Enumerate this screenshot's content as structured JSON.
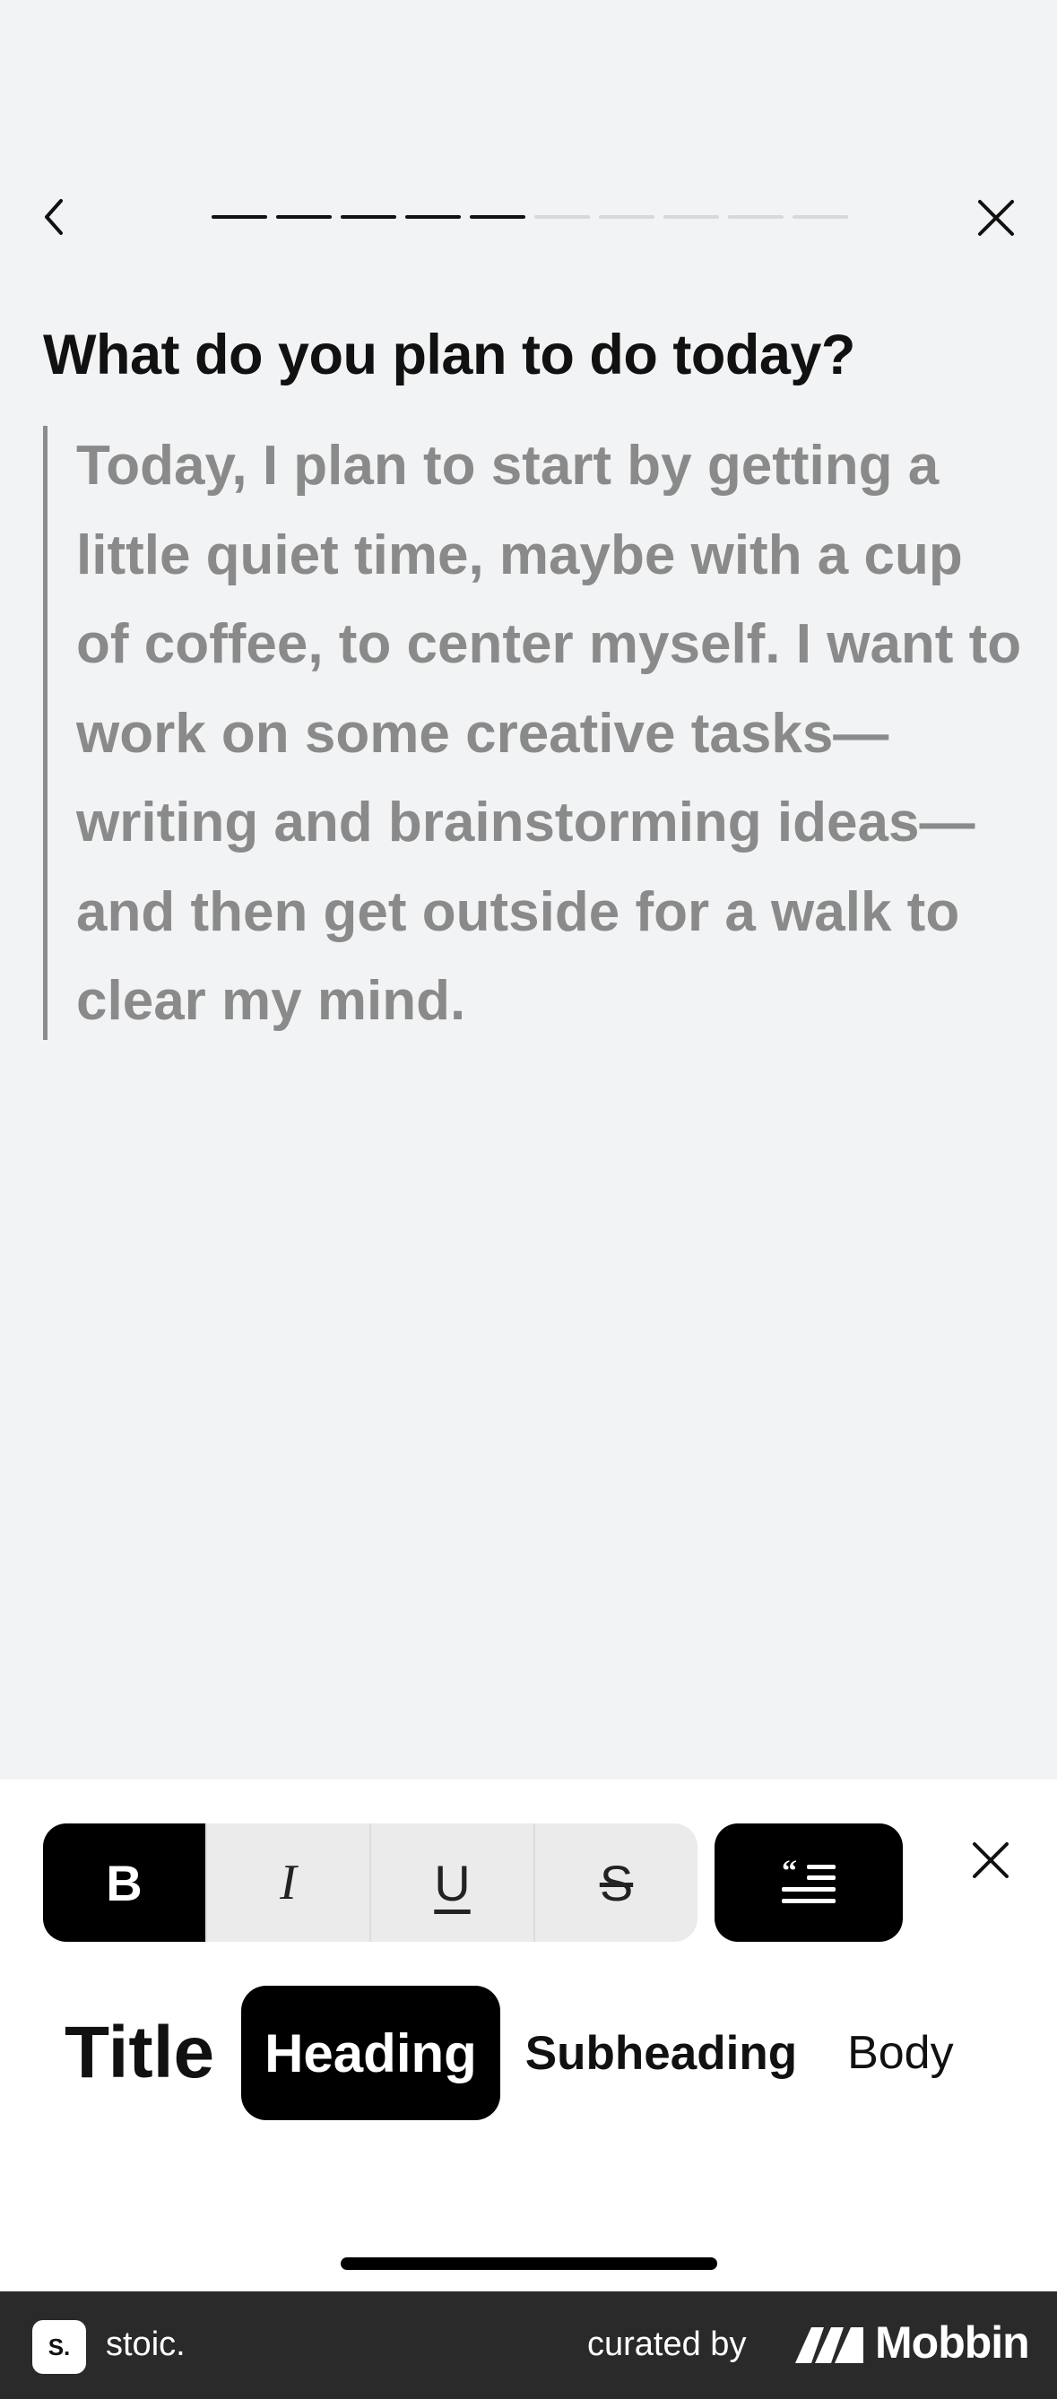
{
  "question": {
    "title": "What do you plan to do today?"
  },
  "answer": {
    "text": "Today, I plan to start by getting a little quiet time, maybe with a cup of coffee, to center myself. I want to work on some creative tasks—writing and brainstorming ideas—and then get outside for a walk to clear my mind."
  },
  "progress": {
    "completed": 5,
    "total": 10,
    "active_color": "#111111",
    "inactive_color": "#d8d8d8"
  },
  "toolbar": {
    "format_buttons": [
      {
        "label": "B",
        "name": "bold-button",
        "active": true
      },
      {
        "label": "I",
        "name": "italic-button",
        "active": false
      },
      {
        "label": "U",
        "name": "underline-button",
        "active": false
      },
      {
        "label": "S",
        "name": "strikethrough-button",
        "active": false
      }
    ],
    "quote_icon": "quote-icon",
    "close_icon": "close-icon"
  },
  "text_styles": [
    {
      "label": "Title",
      "selected": false
    },
    {
      "label": "Heading",
      "selected": true
    },
    {
      "label": "Subheading",
      "selected": false
    },
    {
      "label": "Body",
      "selected": false
    }
  ],
  "footer": {
    "app_badge": "S.",
    "app_name": "stoic.",
    "curated_by": "curated by",
    "brand": "Mobbin"
  }
}
